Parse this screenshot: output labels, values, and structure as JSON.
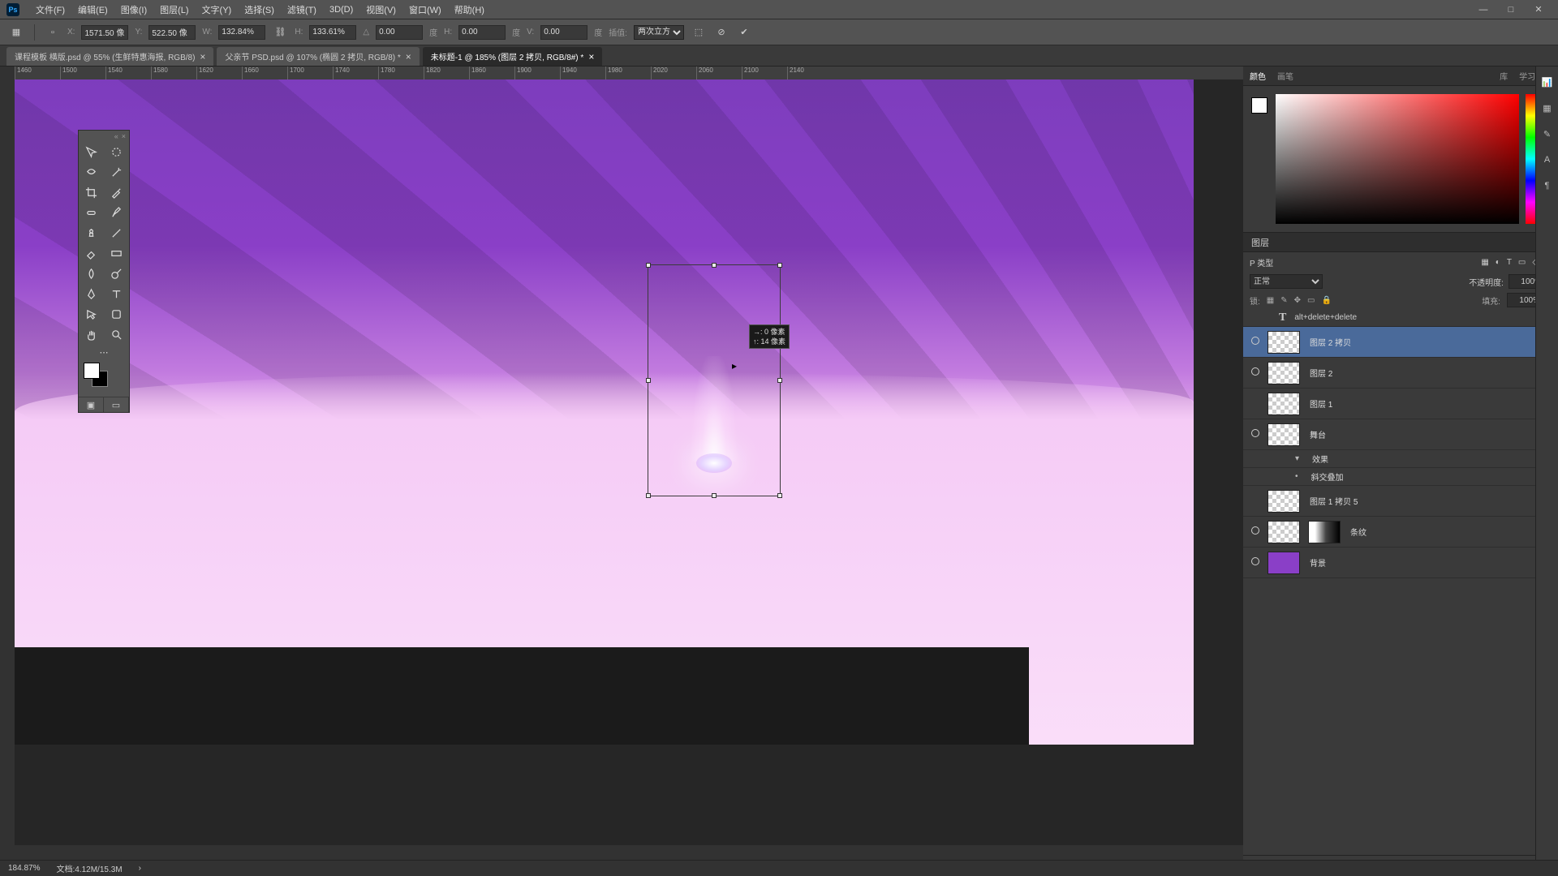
{
  "menu": {
    "items": [
      "文件(F)",
      "编辑(E)",
      "图像(I)",
      "图层(L)",
      "文字(Y)",
      "选择(S)",
      "滤镜(T)",
      "3D(D)",
      "视图(V)",
      "窗口(W)",
      "帮助(H)"
    ]
  },
  "optbar": {
    "x_label": "X:",
    "x": "1571.50 像",
    "y_label": "Y:",
    "y": "522.50 像",
    "w_label": "W:",
    "w": "132.84%",
    "h_label": "H:",
    "h": "133.61%",
    "angle_label": "△",
    "angle": "0.00",
    "hskew_label": "H:",
    "hskew": "0.00",
    "vskew_label": "V:",
    "vskew": "0.00",
    "interp_label": "插值:",
    "interp": "两次立方"
  },
  "tabs": [
    {
      "label": "课程模板 横版.psd @ 55% (生鲜特惠海报, RGB/8)",
      "active": false
    },
    {
      "label": "父亲节 PSD.psd @ 107% (椭圆 2 拷贝, RGB/8) *",
      "active": false
    },
    {
      "label": "未标题-1 @ 185% (图层 2 拷贝, RGB/8#) *",
      "active": true
    }
  ],
  "ruler": {
    "start": 1460,
    "step": 40,
    "count": 18
  },
  "transform_tooltip": {
    "l1": "→: 0 像素",
    "l2": "↑: 14 像素"
  },
  "color_panel": {
    "tabs": [
      "颜色",
      "画笔"
    ],
    "lib": "库",
    "study": "学习"
  },
  "layers_panel": {
    "title": "图层",
    "search_label": "P 类型",
    "blendmode": "正常",
    "opacity_label": "不透明度:",
    "opacity": "100%",
    "fill_label": "填充:",
    "fill": "100%",
    "lock_label": "锁:",
    "tip": "alt+delete+delete",
    "items": [
      {
        "name": "图层 2 拷贝",
        "vis": true,
        "selected": true,
        "thumb": "checker"
      },
      {
        "name": "图层 2",
        "vis": true,
        "thumb": "checker"
      },
      {
        "name": "图层 1",
        "vis": false,
        "thumb": "checker"
      },
      {
        "name": "舞台",
        "vis": true,
        "thumb": "checker",
        "fx": true
      },
      {
        "name": "效果",
        "fxrow": "group",
        "vis": false
      },
      {
        "name": "斜交叠加",
        "fxrow": "item",
        "vis": false
      },
      {
        "name": "图层 1 拷贝 5",
        "vis": false,
        "thumb": "checker"
      },
      {
        "name": "条纹",
        "vis": true,
        "thumb": "checker",
        "mask": true
      },
      {
        "name": "背景",
        "vis": true,
        "thumb": "solid",
        "locked": true
      }
    ]
  },
  "status": {
    "zoom": "184.87%",
    "doc": "文档:4.12M/15.3M"
  }
}
